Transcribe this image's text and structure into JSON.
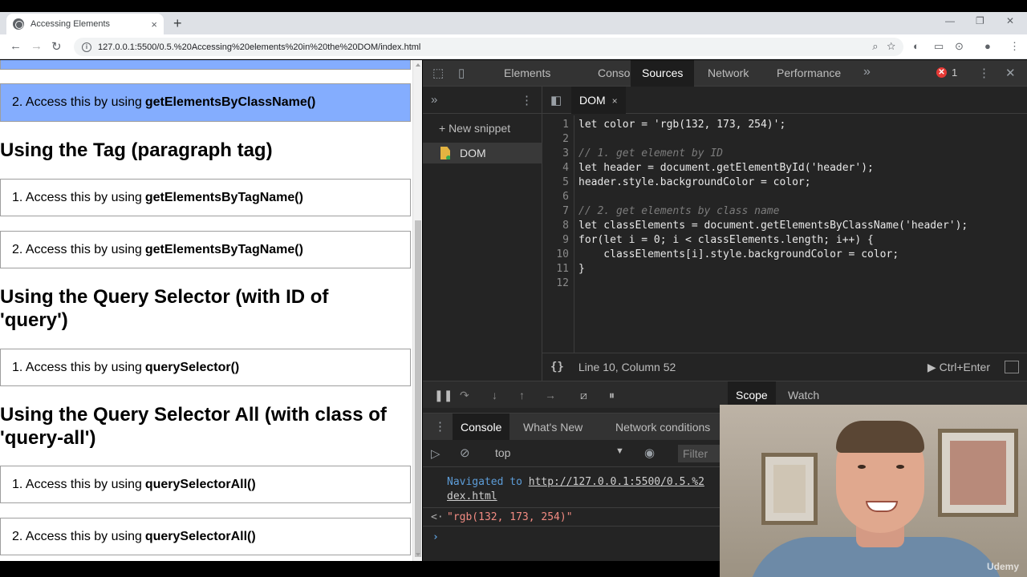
{
  "browser": {
    "tab_title": "Accessing Elements",
    "tab_close": "×",
    "new_tab": "+",
    "url": "127.0.0.1:5500/0.5.%20Accessing%20elements%20in%20the%20DOM/index.html",
    "win_min": "—",
    "win_max": "❐",
    "win_close": "✕"
  },
  "page": {
    "items": [
      {
        "prefix": "2. Access this by using",
        "method": "getElementsByClassName()"
      },
      {
        "prefix": "1. Access this by using",
        "method": "getElementsByTagName()"
      },
      {
        "prefix": "2. Access this by using",
        "method": "getElementsByTagName()"
      },
      {
        "prefix": "1. Access this by using",
        "method": "querySelector()"
      },
      {
        "prefix": "1. Access this by using",
        "method": "querySelectorAll()"
      },
      {
        "prefix": "2. Access this by using",
        "method": "querySelectorAll()"
      }
    ],
    "headings": [
      "Using the Tag (paragraph tag)",
      "Using the Query Selector (with ID of 'query')",
      "Using the Query Selector All (with class of 'query-all')"
    ],
    "highlight_color": "#84adfe"
  },
  "devtools": {
    "tabs": [
      "Elements",
      "Console",
      "Sources",
      "Network",
      "Performance"
    ],
    "active_tab": "Sources",
    "more_tabs": "»",
    "error_count": "1",
    "menu": "⋮",
    "close": "✕",
    "navigator": {
      "new_snippet": "+ New snippet",
      "file": "DOM"
    },
    "editor": {
      "tab": "DOM",
      "tab_close": "×",
      "line_numbers": [
        "1",
        "2",
        "3",
        "4",
        "5",
        "6",
        "7",
        "8",
        "9",
        "10",
        "11",
        "12"
      ],
      "code_lines": [
        "let color = 'rgb(132, 173, 254)';",
        "",
        "// 1. get element by ID",
        "let header = document.getElementById('header');",
        "header.style.backgroundColor = color;",
        "",
        "// 2. get elements by class name",
        "let classElements = document.getElementsByClassName('header');",
        "for(let i = 0; i < classElements.length; i++) {",
        "    classElements[i].style.backgroundColor = color;",
        "}",
        ""
      ],
      "status_brace": "{}",
      "status_position": "Line 10, Column 52",
      "run_label": "▶ Ctrl+Enter"
    },
    "debugger": {
      "scope_tabs": [
        "Scope",
        "Watch"
      ],
      "active": "Scope"
    },
    "drawer": {
      "tabs": [
        "Console",
        "What's New",
        "Network conditions"
      ],
      "active": "Console",
      "context": "top",
      "context_arrow": "▼",
      "filter_placeholder": "Filter",
      "navigated_prefix": "Navigated to",
      "navigated_url_1": "http://127.0.0.1:5500/0.5.%2",
      "navigated_url_2": "dex.html",
      "result_arrow": "<·",
      "result_value": "\"rgb(132, 173, 254)\"",
      "prompt": "›"
    }
  },
  "webcam": {
    "watermark": "Udemy"
  }
}
